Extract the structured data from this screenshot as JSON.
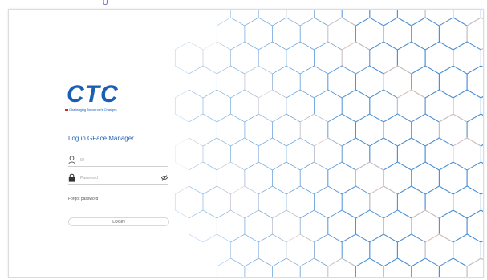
{
  "brand": {
    "logo_text": "CTC",
    "tagline": "Challenging Tomorrow's Changes",
    "primary_color": "#1b5fb4",
    "accent_color": "#d9262a"
  },
  "login": {
    "title": "Log in GFace Manager",
    "username_placeholder": "ID",
    "password_placeholder": "Password",
    "forgot_label": "Forgot password",
    "submit_label": "LOGIN"
  },
  "icons": {
    "user": "user-icon",
    "lock": "lock-icon",
    "eye": "eye-icon"
  },
  "background": {
    "pattern": "hexagon-mesh",
    "line_color_primary": "#4a8fd6",
    "line_color_secondary": "#d9c0b8"
  }
}
